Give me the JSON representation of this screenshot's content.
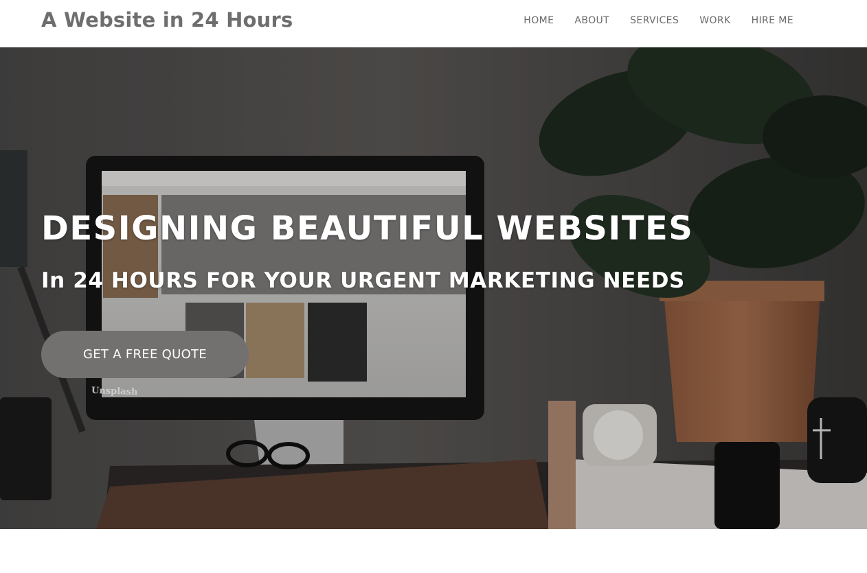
{
  "header": {
    "brand": "A Website in 24 Hours",
    "nav": [
      "HOME",
      "ABOUT",
      "SERVICES",
      "WORK",
      "HIRE ME"
    ]
  },
  "hero": {
    "title": "DESIGNING BEAUTIFUL WEBSITES",
    "subtitle": "In 24 HOURS FOR YOUR URGENT MARKETING NEEDS",
    "cta_label": "GET A FREE QUOTE",
    "photo_watermark": "Unsplash"
  },
  "colors": {
    "brand_text": "#6e6e6e",
    "nav_text": "#6b6b6b",
    "cta_background": "#737170",
    "hero_text": "#ffffff"
  }
}
